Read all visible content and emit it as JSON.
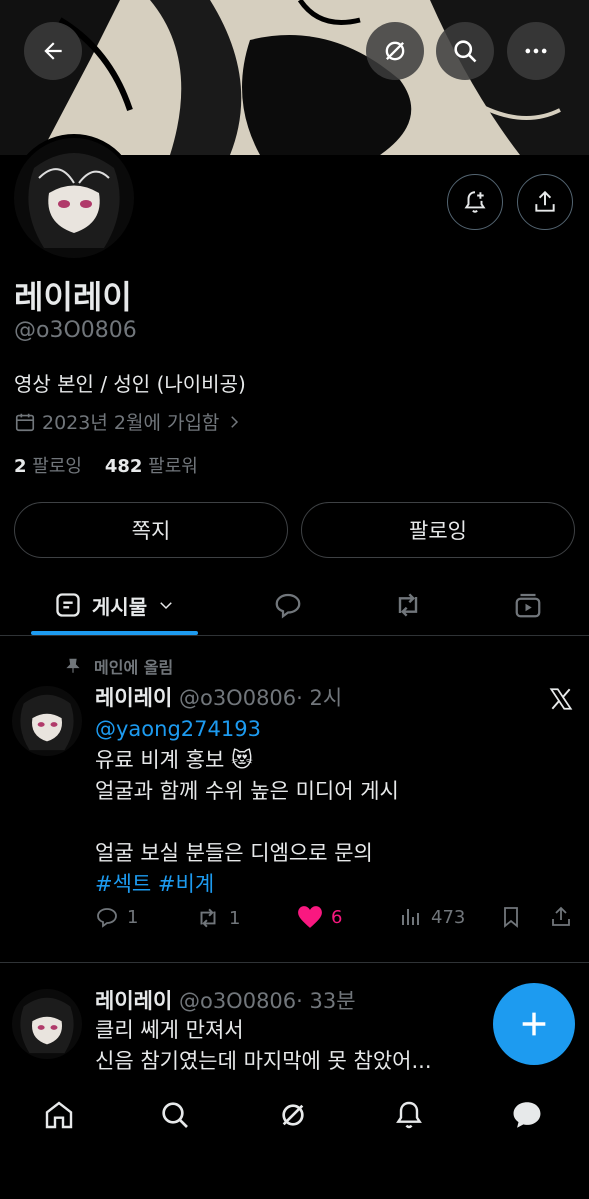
{
  "profile": {
    "name": "레이레이",
    "handle": "@o3O0806",
    "bio": "영상 본인 / 성인 (나이비공)",
    "joined": "2023년 2월에 가입함",
    "following_count": "2",
    "following_label": "팔로잉",
    "followers_count": "482",
    "followers_label": "팔로워"
  },
  "buttons": {
    "message": "쪽지",
    "following": "팔로잉"
  },
  "tabs": {
    "posts": "게시물"
  },
  "pinned_label": "메인에 올림",
  "posts": [
    {
      "name": "레이레이",
      "handle": "@o3O0806",
      "time": "· 2시",
      "mention": "@yaong274193",
      "line1": "유료 비계 홍보 😻",
      "line2": "얼굴과 함께 수위 높은 미디어 게시",
      "line3": "얼굴 보실 분들은 디엠으로 문의",
      "hashtags": "#섹트 #비계",
      "replies": "1",
      "reposts": "1",
      "likes": "6",
      "views": "473"
    },
    {
      "name": "레이레이",
      "handle": "@o3O0806",
      "time": "· 33분",
      "line1": "클리 쎄게 만져서",
      "line2": "신음 참기였는데 마지막에 못 참았어..."
    }
  ],
  "colors": {
    "accent": "#1d9bf0",
    "like": "#f91880",
    "muted": "#71767b"
  }
}
